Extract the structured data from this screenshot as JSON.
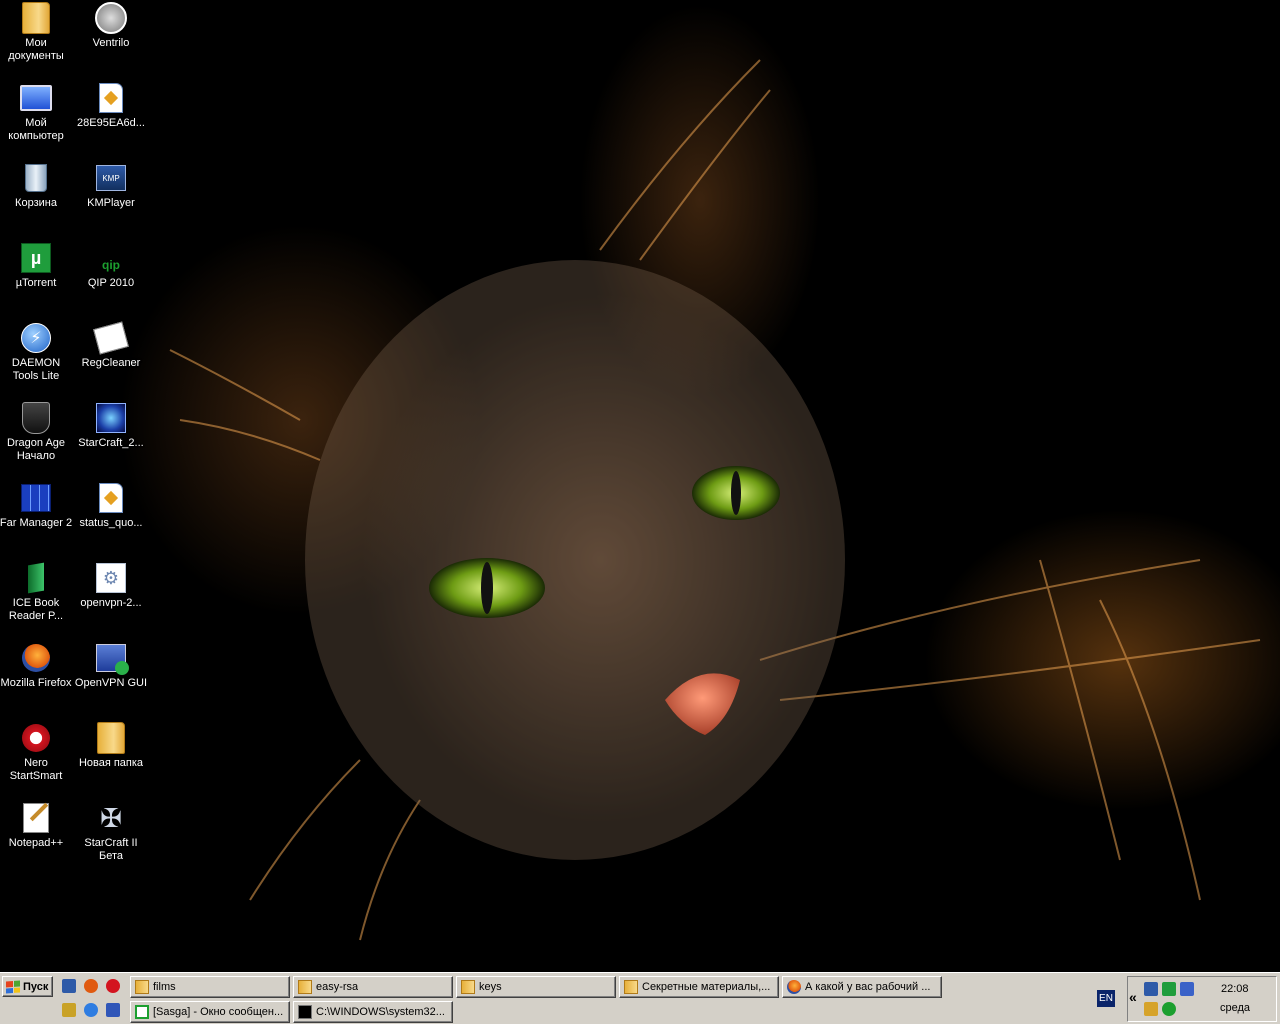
{
  "desktop": {
    "icons": [
      {
        "label": "Мои документы",
        "icon": "folder-icon"
      },
      {
        "label": "Ventrilo",
        "icon": "headset-icon"
      },
      {
        "label": "Мой компьютер",
        "icon": "monitor-icon"
      },
      {
        "label": "28E95EA6d...",
        "icon": "document-icon"
      },
      {
        "label": "Корзина",
        "icon": "recycle-bin-icon"
      },
      {
        "label": "KMPlayer",
        "icon": "kmplayer-icon"
      },
      {
        "label": "µTorrent",
        "icon": "utorrent-icon"
      },
      {
        "label": "QIP 2010",
        "icon": "qip-icon"
      },
      {
        "label": "DAEMON Tools Lite",
        "icon": "daemon-tools-icon"
      },
      {
        "label": "RegCleaner",
        "icon": "regcleaner-icon"
      },
      {
        "label": "Dragon Age Начало",
        "icon": "dragon-age-icon"
      },
      {
        "label": "StarCraft_2...",
        "icon": "starcraft-installer-icon"
      },
      {
        "label": "Far Manager 2",
        "icon": "far-manager-icon"
      },
      {
        "label": "status_quo...",
        "icon": "document-icon"
      },
      {
        "label": "ICE Book Reader P...",
        "icon": "book-reader-icon"
      },
      {
        "label": "openvpn-2...",
        "icon": "installer-icon"
      },
      {
        "label": "Mozilla Firefox",
        "icon": "firefox-icon"
      },
      {
        "label": "OpenVPN GUI",
        "icon": "openvpn-icon"
      },
      {
        "label": "Nero StartSmart",
        "icon": "nero-icon"
      },
      {
        "label": "Новая папка",
        "icon": "folder-icon"
      },
      {
        "label": "Notepad++",
        "icon": "notepad-icon"
      },
      {
        "label": "StarCraft II Бета",
        "icon": "starcraft2-icon"
      }
    ]
  },
  "taskbar": {
    "start_label": "Пуск",
    "quick_launch_icons": [
      "show-desktop-icon",
      "firefox-icon",
      "nero-icon",
      "utorrent-icon",
      "internet-explorer-icon",
      "monitor-icon"
    ],
    "tasks_row1": [
      {
        "label": "films",
        "icon": "folder-icon"
      },
      {
        "label": "easy-rsa",
        "icon": "folder-icon"
      },
      {
        "label": "keys",
        "icon": "folder-icon"
      },
      {
        "label": "Секретные материалы,...",
        "icon": "folder-icon"
      },
      {
        "label": "А какой у вас рабочий ...",
        "icon": "firefox-icon"
      }
    ],
    "tasks_row2": [
      {
        "label": "[Sasga] - Окно сообщен...",
        "icon": "chat-icon"
      },
      {
        "label": "C:\\WINDOWS\\system32...",
        "icon": "cmd-icon"
      }
    ],
    "language": "EN",
    "tray_chevron": "«",
    "clock_time": "22:08",
    "clock_day": "среда"
  }
}
